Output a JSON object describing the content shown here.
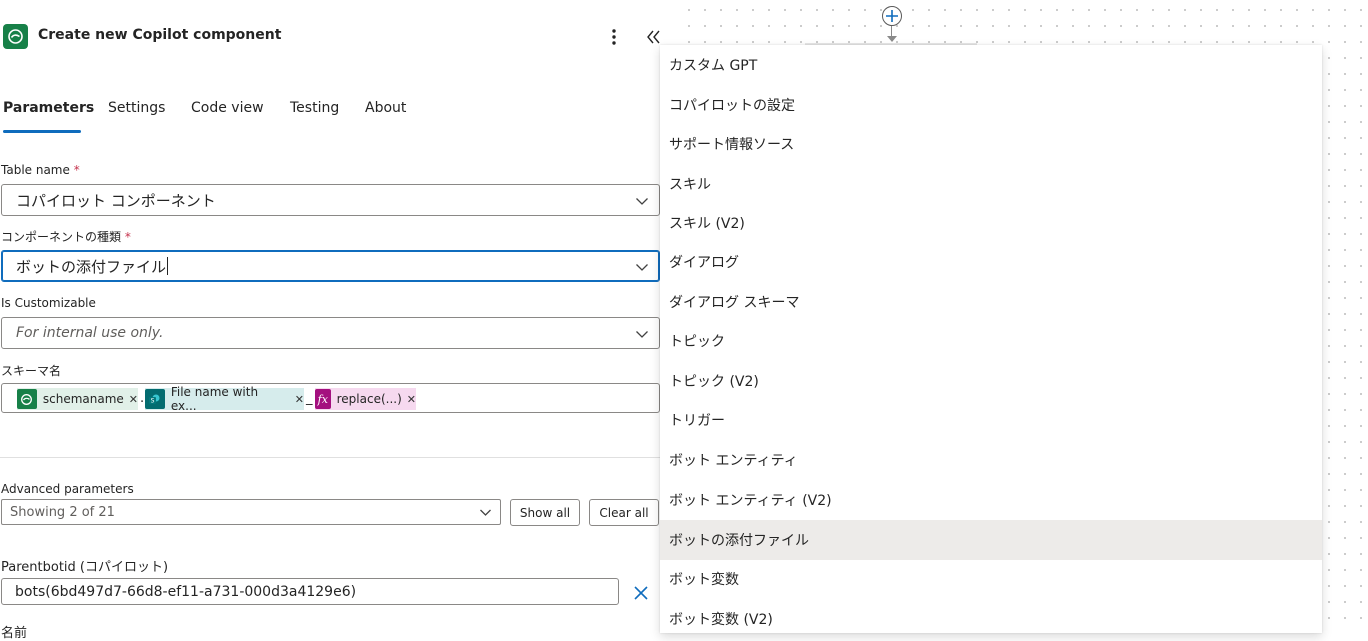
{
  "panel": {
    "title": "Create new Copilot component",
    "tabs": [
      {
        "label": "Parameters",
        "active": true
      },
      {
        "label": "Settings",
        "active": false
      },
      {
        "label": "Code view",
        "active": false
      },
      {
        "label": "Testing",
        "active": false
      },
      {
        "label": "About",
        "active": false
      }
    ]
  },
  "fields": {
    "table_name": {
      "label": "Table name",
      "required_mark": "*",
      "value": "コパイロット コンポーネント"
    },
    "component_type": {
      "label": "コンポーネントの種類",
      "required_mark": "*",
      "value": "ボットの添付ファイル"
    },
    "is_customizable": {
      "label": "Is Customizable",
      "placeholder": "For internal use only."
    },
    "schema_name": {
      "label": "スキーマ名",
      "tokens": [
        {
          "text": "schemaname",
          "icon": "dataverse-icon",
          "color": "#178048",
          "bg": "#e1f0e8"
        },
        {
          "text": "File name with ex...",
          "icon": "sharepoint-icon",
          "color": "#036c70",
          "bg": "#d6ecec"
        },
        {
          "text": "replace(...)",
          "icon": "function-icon",
          "color": "#a4107f",
          "bg": "#f6d9ef"
        }
      ],
      "separators": [
        ".",
        "_"
      ]
    }
  },
  "advanced": {
    "label": "Advanced parameters",
    "selector": "Showing 2 of 21",
    "show_all": "Show all",
    "clear_all": "Clear all"
  },
  "parentbotid": {
    "label": "Parentbotid (コパイロット)",
    "value": "bots(6bd497d7-66d8-ef11-a731-000d3a4129e6)"
  },
  "next_label": "名前",
  "dropdown": {
    "options": [
      "カスタム GPT",
      "コパイロットの設定",
      "サポート情報ソース",
      "スキル",
      "スキル (V2)",
      "ダイアログ",
      "ダイアログ スキーマ",
      "トピック",
      "トピック (V2)",
      "トリガー",
      "ボット エンティティ",
      "ボット エンティティ (V2)",
      "ボットの添付ファイル",
      "ボット変数",
      "ボット変数 (V2)"
    ],
    "selected_index": 12
  },
  "colors": {
    "accent": "#0f6cbd",
    "required": "#c4314b",
    "selected_bg": "#edebe9"
  }
}
